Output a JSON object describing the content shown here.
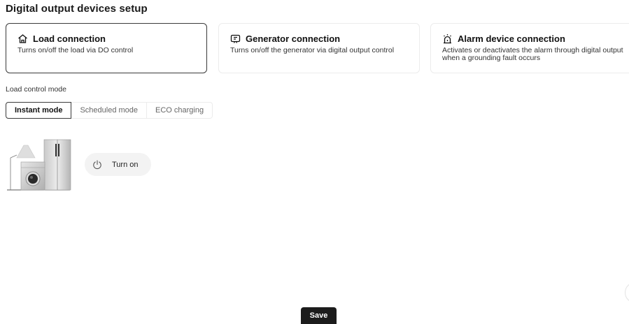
{
  "page": {
    "title": "Digital output devices setup"
  },
  "cards": [
    {
      "icon": "home-icon",
      "title": "Load connection",
      "description": "Turns on/off the load via DO control",
      "selected": true
    },
    {
      "icon": "generator-icon",
      "title": "Generator connection",
      "description": "Turns on/off the generator via digital output control",
      "selected": false
    },
    {
      "icon": "alarm-icon",
      "title": "Alarm device connection",
      "description": "Activates or deactivates the alarm through digital output when a grounding fault occurs",
      "selected": false
    }
  ],
  "load_control": {
    "label": "Load control mode",
    "modes": [
      {
        "label": "Instant mode",
        "selected": true
      },
      {
        "label": "Scheduled mode",
        "selected": false
      },
      {
        "label": "ECO charging",
        "selected": false
      }
    ]
  },
  "appliance_image": {
    "icon": "home-appliances-icon"
  },
  "power_button": {
    "icon": "power-icon",
    "label": "Turn on"
  },
  "footer": {
    "save_label": "Save"
  },
  "colors": {
    "primary": "#1c1c1c",
    "selected_border": "#3a3a3a",
    "card_border": "#ececec",
    "pill_bg": "#f3f3f3"
  }
}
